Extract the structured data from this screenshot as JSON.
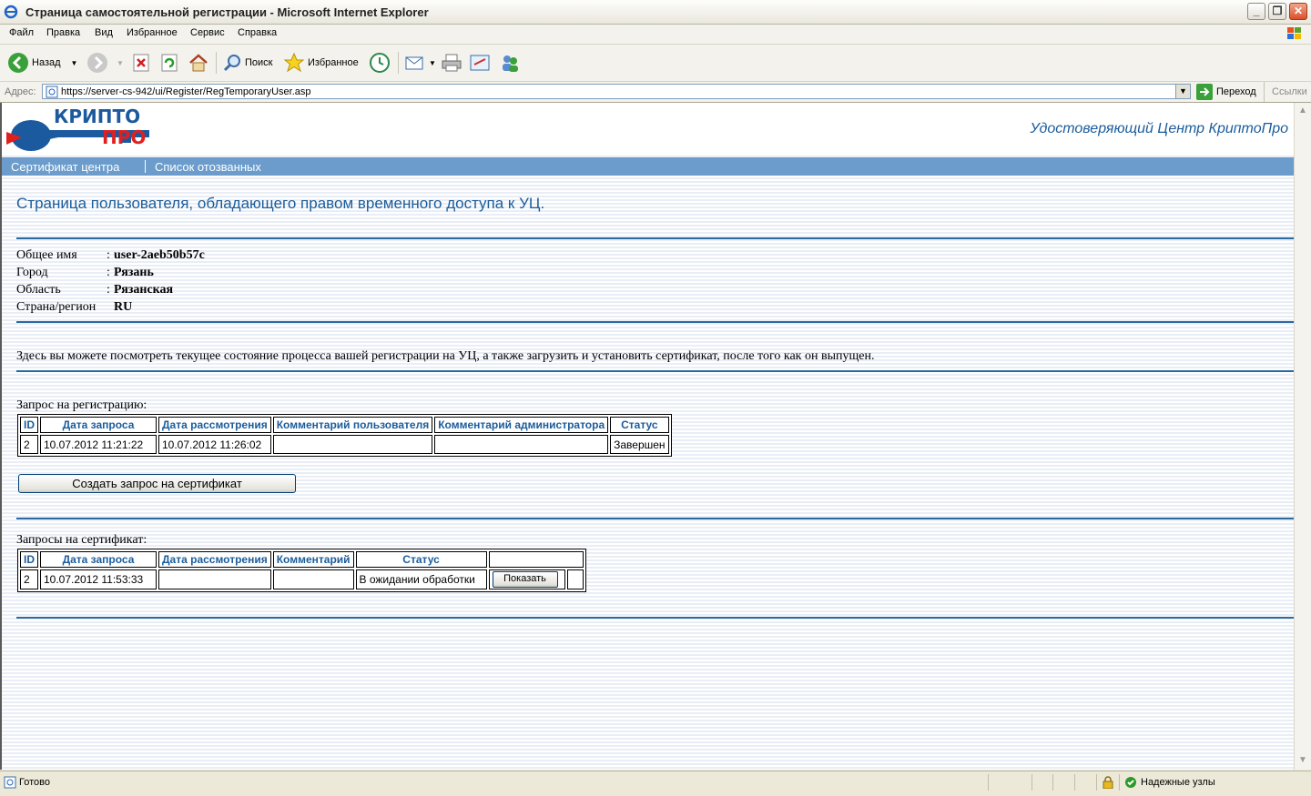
{
  "window": {
    "title": "Страница самостоятельной регистрации - Microsoft Internet Explorer"
  },
  "menu": [
    "Файл",
    "Правка",
    "Вид",
    "Избранное",
    "Сервис",
    "Справка"
  ],
  "toolbar": {
    "back": "Назад",
    "search": "Поиск",
    "favorites": "Избранное"
  },
  "address": {
    "label": "Адрес:",
    "url": "https://server-cs-942/ui/Register/RegTemporaryUser.asp",
    "go": "Переход",
    "links": "Ссылки"
  },
  "page": {
    "logo": {
      "line1": "КРИПТО",
      "line2": "ПРО"
    },
    "ca_title": "Удостоверяющий Центр КриптоПро",
    "nav": [
      "Сертификат центра",
      "Список отозванных"
    ],
    "title": "Страница пользователя, обладающего правом временного доступа к УЦ.",
    "fields": [
      {
        "label": "Общее имя",
        "colon": ":",
        "value": "user-2aeb50b57c"
      },
      {
        "label": "Город",
        "colon": ":",
        "value": "Рязань"
      },
      {
        "label": "Область",
        "colon": ":",
        "value": "Рязанская"
      },
      {
        "label": "Страна/регион",
        "colon": ":",
        "value": "RU"
      }
    ],
    "description": "Здесь вы можете посмотреть текущее состояние процесса вашей регистрации на УЦ, а также загрузить и установить сертификат, после того как он выпущен.",
    "reg": {
      "caption": "Запрос на регистрацию:",
      "headers": [
        "ID",
        "Дата запроса",
        "Дата рассмотрения",
        "Комментарий пользователя",
        "Комментарий администратора",
        "Статус"
      ],
      "rows": [
        [
          "2",
          "10.07.2012 11:21:22",
          "10.07.2012 11:26:02",
          "",
          "",
          "Завершен"
        ]
      ]
    },
    "create_button": "Создать запрос на сертификат",
    "cert": {
      "caption": "Запросы на сертификат:",
      "headers": [
        "ID",
        "Дата запроса",
        "Дата рассмотрения",
        "Комментарий",
        "Статус",
        ""
      ],
      "rows": [
        [
          "2",
          "10.07.2012 11:53:33",
          "",
          "",
          "В ожидании обработки"
        ]
      ],
      "show_button": "Показать"
    }
  },
  "status": {
    "text": "Готово",
    "zone": "Надежные узлы"
  }
}
